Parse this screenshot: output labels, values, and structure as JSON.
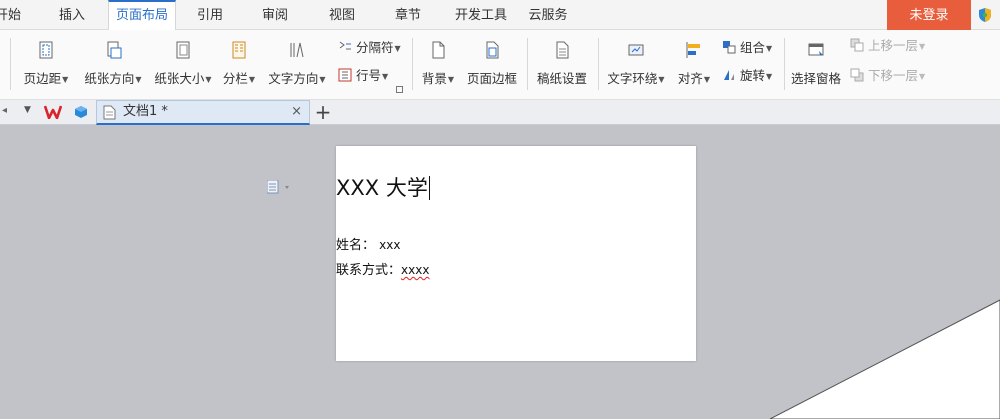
{
  "menu": {
    "tabs": [
      "开始",
      "插入",
      "页面布局",
      "引用",
      "审阅",
      "视图",
      "章节",
      "开发工具",
      "云服务"
    ],
    "active_tab": "页面布局",
    "login_label": "未登录"
  },
  "ribbon": {
    "margins": "页边距",
    "orientation": "纸张方向",
    "size": "纸张大小",
    "columns": "分栏",
    "text_direction": "文字方向",
    "breaks": "分隔符",
    "line_numbers": "行号",
    "background": "背景",
    "page_border": "页面边框",
    "manuscript": "稿纸设置",
    "text_wrap": "文字环绕",
    "align": "对齐",
    "group": "组合",
    "rotate": "旋转",
    "selection_pane": "选择窗格",
    "bring_forward": "上移一层",
    "send_backward": "下移一层"
  },
  "tabs": {
    "document_name": "文档1 *",
    "close": "×",
    "new": "+"
  },
  "document": {
    "title": "XXX 大学",
    "name_label": "姓名：",
    "name_value": "xxx",
    "contact_label": "联系方式：",
    "contact_value": "xxxx"
  },
  "colors": {
    "accent": "#2b6fcb",
    "login": "#e85d3c",
    "workspace": "#c1c3c9"
  }
}
